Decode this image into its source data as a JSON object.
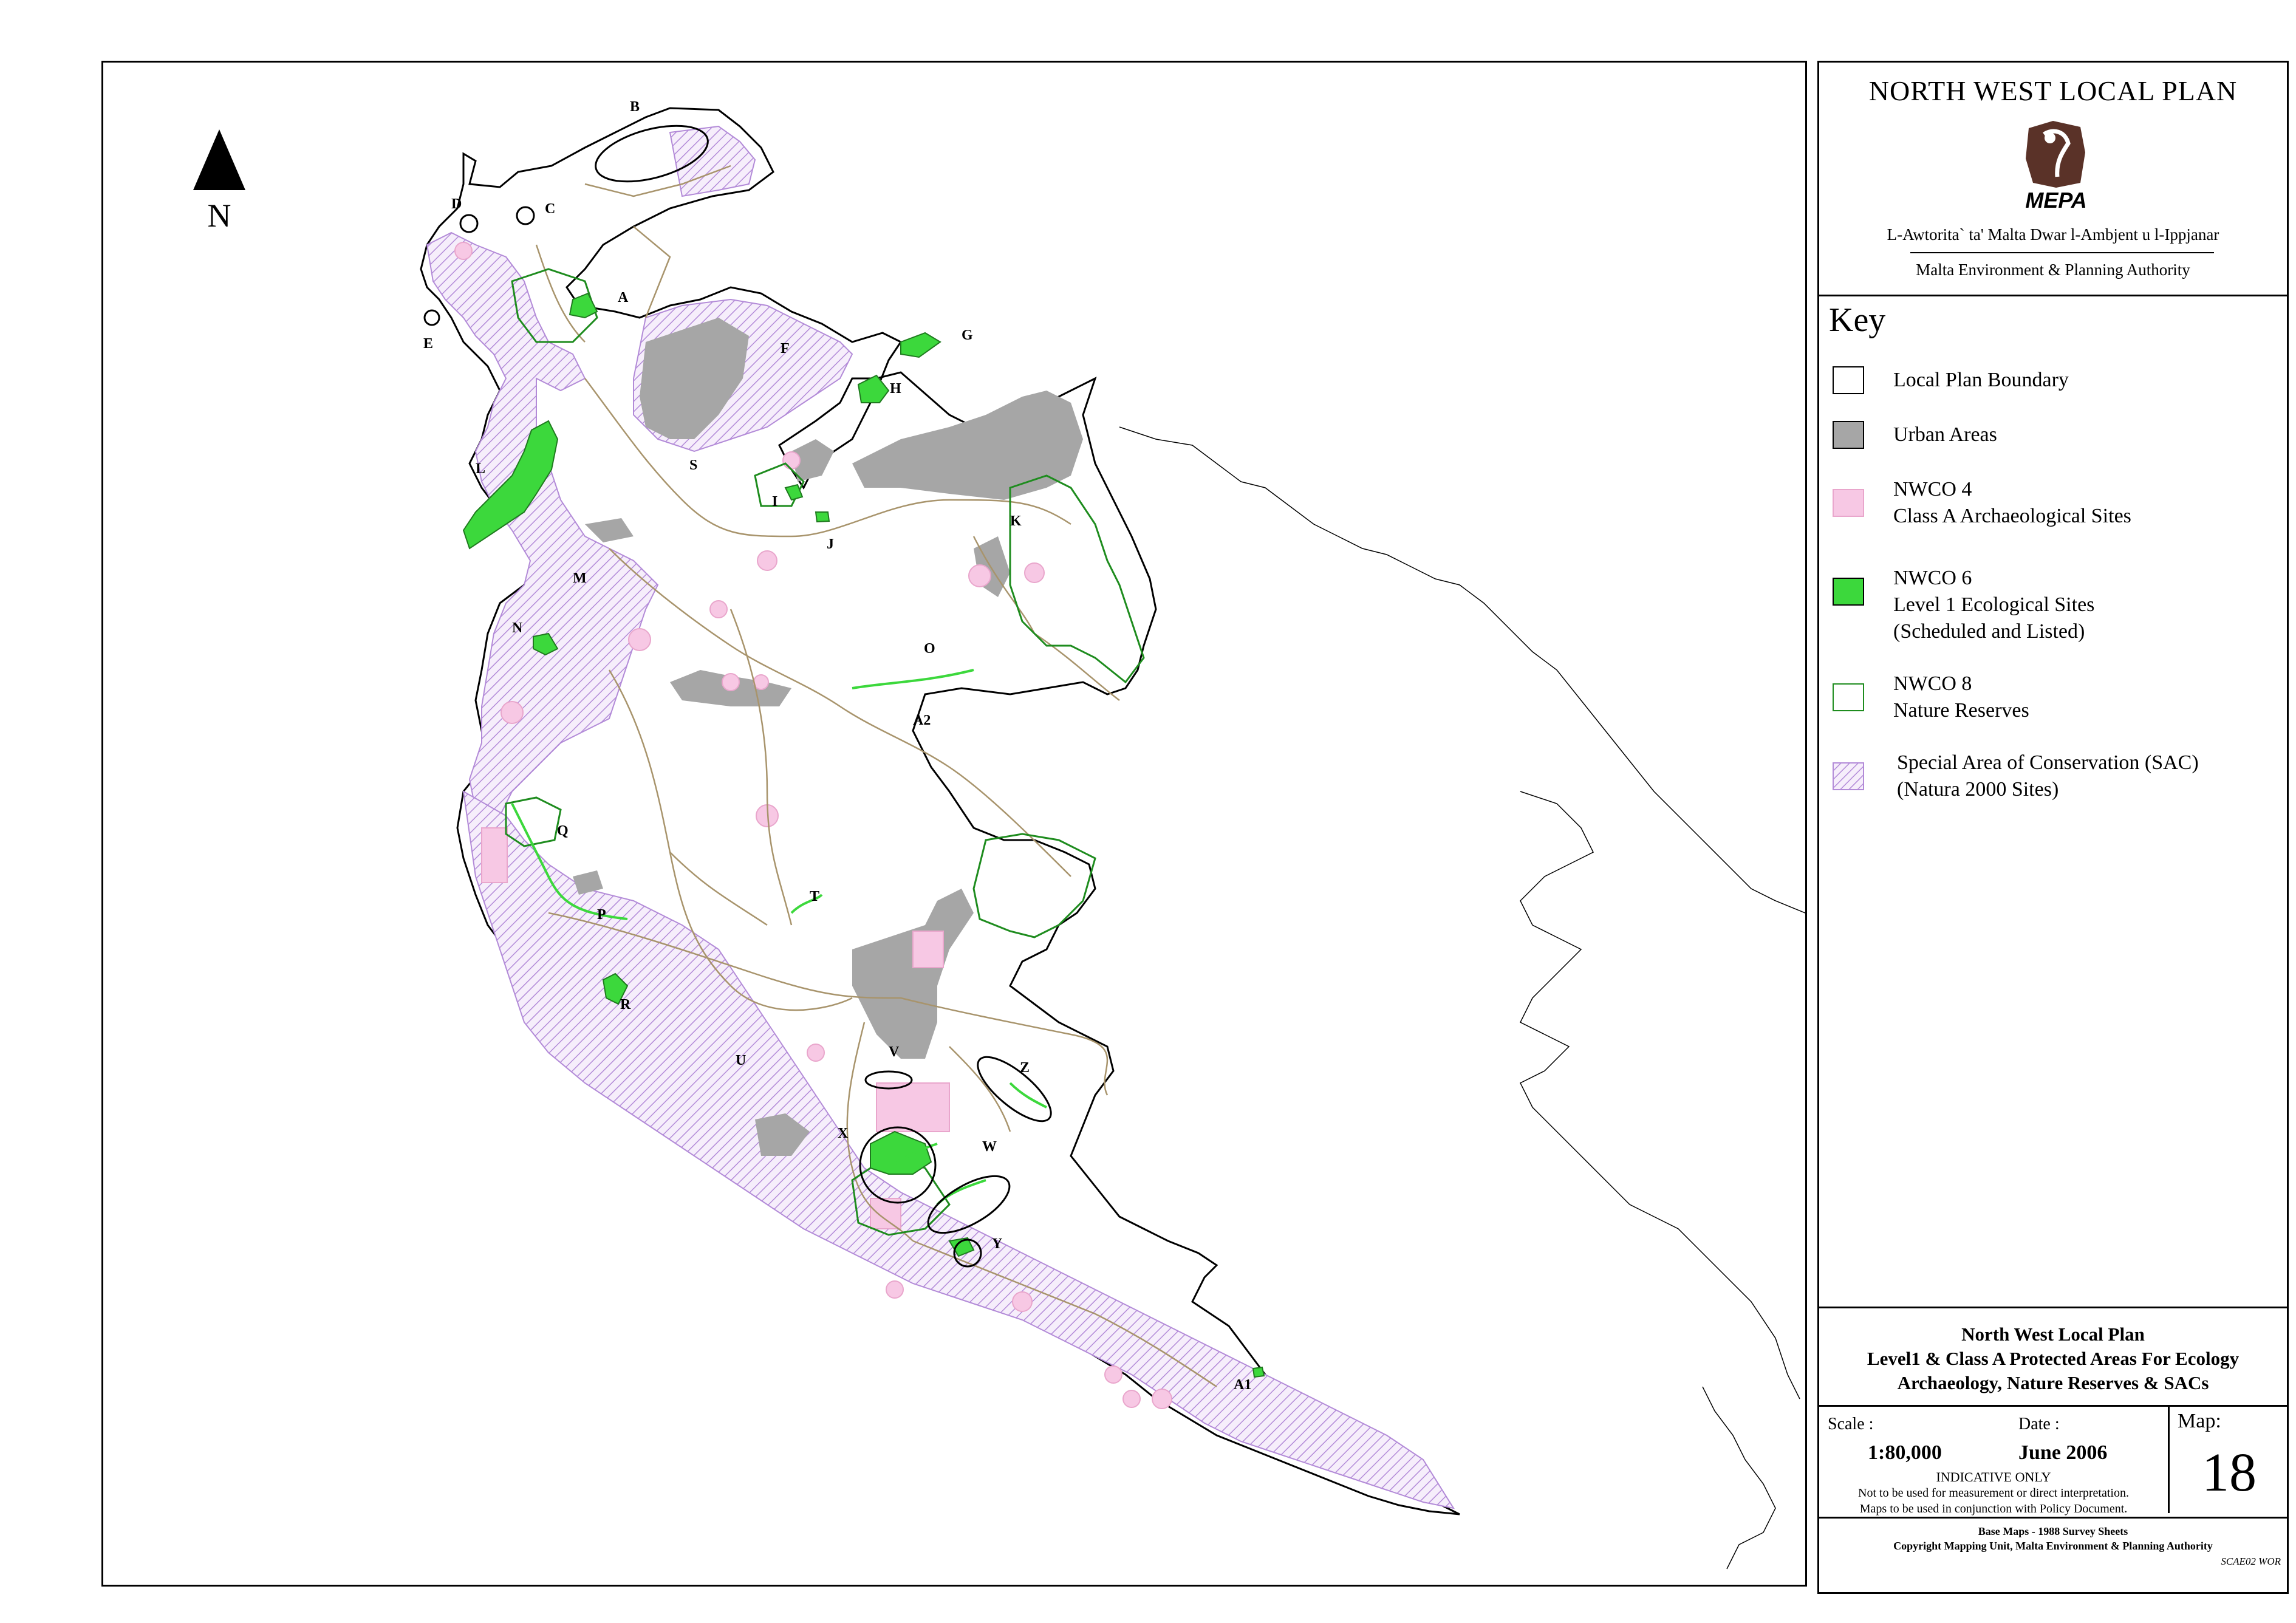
{
  "map": {
    "north_label": "N",
    "site_labels": [
      "A",
      "B",
      "C",
      "D",
      "E",
      "F",
      "G",
      "H",
      "I",
      "J",
      "K",
      "L",
      "M",
      "N",
      "O",
      "P",
      "Q",
      "R",
      "S",
      "T",
      "U",
      "V",
      "W",
      "X",
      "Y",
      "Z",
      "A1",
      "A2"
    ]
  },
  "panel": {
    "title": "NORTH WEST LOCAL PLAN",
    "logo_text": "MEPA",
    "authority_mt": "L-Awtorita` ta' Malta Dwar l-Ambjent u l-Ippjanar",
    "authority_en": "Malta Environment & Planning Authority",
    "key_title": "Key",
    "key_items": [
      {
        "lines": [
          "Local Plan Boundary"
        ],
        "symbol": "boundary"
      },
      {
        "lines": [
          "Urban Areas"
        ],
        "symbol": "urban"
      },
      {
        "lines": [
          "NWCO 4",
          "Class A Archaeological Sites"
        ],
        "symbol": "archaeology"
      },
      {
        "lines": [
          "NWCO 6",
          "Level 1 Ecological Sites",
          "(Scheduled and Listed)"
        ],
        "symbol": "ecology"
      },
      {
        "lines": [
          "NWCO 8",
          "Nature Reserves"
        ],
        "symbol": "nature-reserve"
      },
      {
        "lines": [
          "Special Area of Conservation (SAC)",
          "(Natura 2000 Sites)"
        ],
        "symbol": "sac"
      }
    ],
    "plan_title_lines": [
      "North West Local Plan",
      "Level1 & Class A Protected Areas For Ecology",
      "Archaeology, Nature Reserves & SACs"
    ],
    "scale_label": "Scale :",
    "scale_value": "1:80,000",
    "date_label": "Date :",
    "date_value": "June 2006",
    "indicative": "INDICATIVE ONLY",
    "note_1": "Not to be used for measurement or direct interpretation.",
    "note_2": "Maps to be used in conjunction with Policy Document.",
    "map_label": "Map:",
    "map_number": "18",
    "credit_1": "Base Maps - 1988 Survey Sheets",
    "credit_2": "Copyright Mapping Unit, Malta Environment & Planning Authority",
    "file_code": "SCAE02 WOR"
  },
  "colors": {
    "urban": "#a6a6a6",
    "archaeology": "#f7c8e4",
    "ecology": "#3cd83c",
    "nature_reserve": "#1e8c1e",
    "sac_hatch": "#b38bd8",
    "roads": "#a8946c",
    "logo_brown": "#5a3228"
  }
}
